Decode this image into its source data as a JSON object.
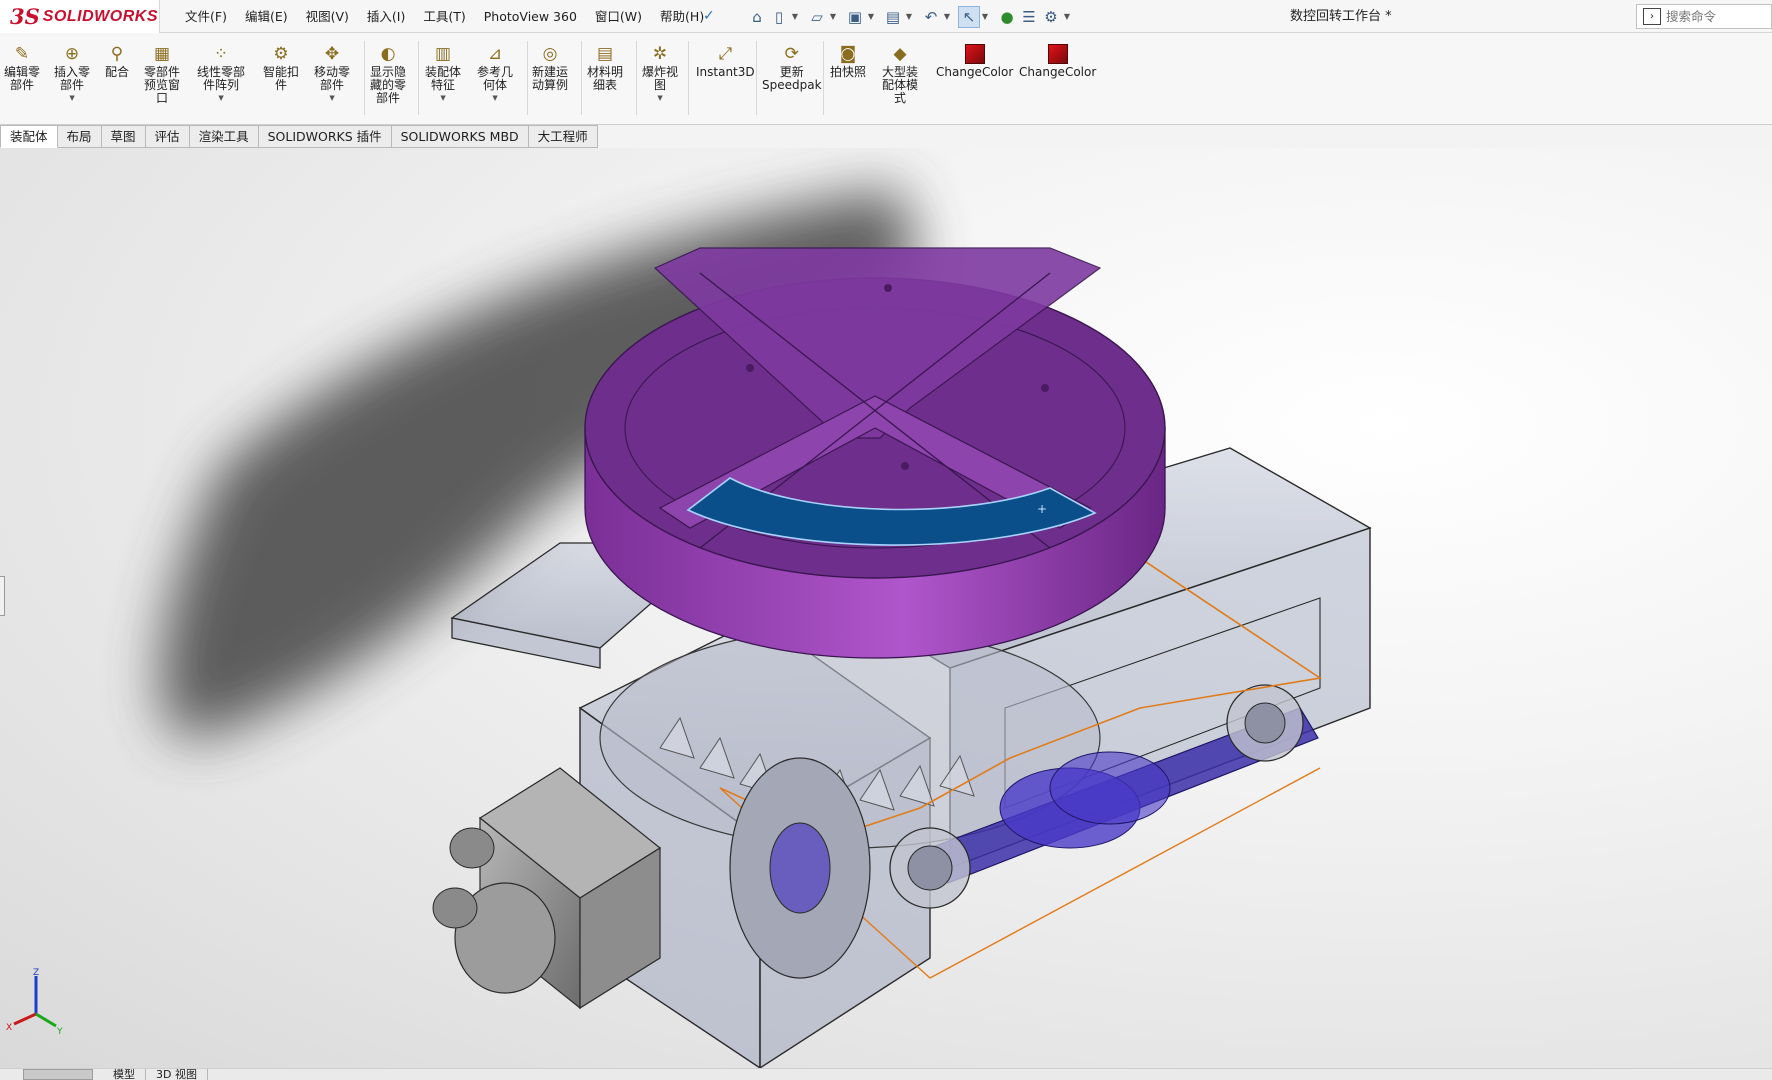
{
  "app": {
    "brand_prefix": "3S",
    "brand_name": "SOLIDWORKS",
    "document_title": "数控回转工作台 *"
  },
  "menu": [
    "文件(F)",
    "编辑(E)",
    "视图(V)",
    "插入(I)",
    "工具(T)",
    "PhotoView 360",
    "窗口(W)",
    "帮助(H)"
  ],
  "quick_access": {
    "items": [
      "home-icon",
      "new-document-icon",
      "open-icon",
      "save-icon",
      "print-icon",
      "undo-icon",
      "select-icon",
      "traffic-light-icon",
      "file-properties-icon",
      "options-icon"
    ]
  },
  "search": {
    "placeholder": "搜索命令"
  },
  "ribbon": {
    "tools": [
      {
        "label": "编辑零\n部件",
        "icon": "edit-component-icon",
        "dropdown": false
      },
      {
        "label": "插入零\n部件",
        "icon": "insert-component-icon",
        "dropdown": true
      },
      {
        "label": "配合",
        "icon": "mate-icon",
        "dropdown": false
      },
      {
        "label": "零部件\n预览窗\n口",
        "icon": "component-preview-icon",
        "dropdown": false
      },
      {
        "label": "线性零部\n件阵列",
        "icon": "linear-pattern-icon",
        "dropdown": true
      },
      {
        "label": "智能扣\n件",
        "icon": "smart-fasteners-icon",
        "dropdown": false
      },
      {
        "label": "移动零\n部件",
        "icon": "move-component-icon",
        "dropdown": true
      },
      {
        "label": "显示隐\n藏的零\n部件",
        "icon": "show-hidden-icon",
        "dropdown": false
      },
      {
        "label": "装配体\n特征",
        "icon": "assembly-features-icon",
        "dropdown": true
      },
      {
        "label": "参考几\n何体",
        "icon": "reference-geometry-icon",
        "dropdown": true
      },
      {
        "label": "新建运\n动算例",
        "icon": "motion-study-icon",
        "dropdown": false
      },
      {
        "label": "材料明\n细表",
        "icon": "bill-of-materials-icon",
        "dropdown": false
      },
      {
        "label": "爆炸视\n图",
        "icon": "exploded-view-icon",
        "dropdown": true
      },
      {
        "label": "Instant3D",
        "icon": "instant3d-icon",
        "dropdown": false
      },
      {
        "label": "更新\nSpeedpak",
        "icon": "speedpak-icon",
        "dropdown": false
      },
      {
        "label": "拍快照",
        "icon": "snapshot-icon",
        "dropdown": false
      },
      {
        "label": "大型装\n配体模\n式",
        "icon": "large-assembly-icon",
        "dropdown": false
      },
      {
        "label": "ChangeColor",
        "icon": "change-color-swatch-icon",
        "dropdown": false
      },
      {
        "label": "ChangeColor",
        "icon": "change-color-swatch-icon",
        "dropdown": false
      }
    ]
  },
  "tabs": [
    "装配体",
    "布局",
    "草图",
    "评估",
    "渲染工具",
    "SOLIDWORKS 插件",
    "SOLIDWORKS MBD",
    "大工程师"
  ],
  "triad": {
    "x": "X",
    "y": "Y",
    "z": "Z"
  },
  "bottom_tabs": [
    "模型",
    "3D 视图"
  ],
  "colors": {
    "turntable": "#6e2e8c",
    "turntable_highlight": "#8e44ad",
    "selected_face": "#0b4f8a",
    "housing_glass": "#9aa7c4",
    "motor": "#8a8a8a",
    "worm_screw": "#3b2fa8",
    "path_line": "#e07b1a",
    "shadow": "#5a5a5a",
    "brand": "#c8102e",
    "active_tool": "#cfe0f3"
  }
}
